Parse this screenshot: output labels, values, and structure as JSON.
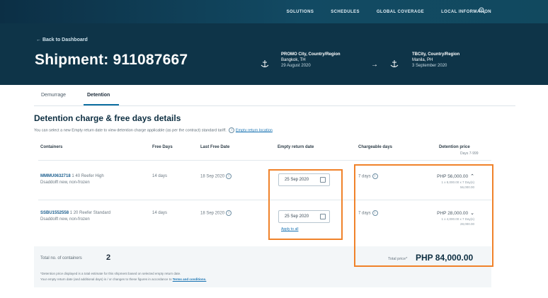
{
  "nav": {
    "links": [
      "SOLUTIONS",
      "SCHEDULES",
      "GLOBAL COVERAGE",
      "LOCAL INFORMATION"
    ]
  },
  "header": {
    "back_label": "← Back to Dashboard",
    "title": "Shipment: 911087667",
    "origin": {
      "location": "PROMO City, Country/Region",
      "city": "Bangkok, TH",
      "date": "29 August 2020"
    },
    "destination": {
      "location": "TBCity, Country/Region",
      "city": "Manila, PH",
      "date": "3 September 2020"
    }
  },
  "tabs": [
    "Demurrage",
    "Detention"
  ],
  "section": {
    "title": "Detention charge & free days details",
    "description": "You can select a new Empty return date to view detention charge applicable (as per the contract) standard tariff.",
    "link": "Empty return location"
  },
  "table": {
    "headers": [
      "Containers",
      "Free Days",
      "Last Free Date",
      "Empty return date",
      "Chargeable days",
      "Detention price"
    ],
    "price_sub": "Days 7-999",
    "rows": [
      {
        "container_id": "MMMU0632718",
        "container_desc": "1 40 Reefer High",
        "container_desc2": "Dsaddolft new, non-frozen",
        "free_days": "14 days",
        "last_free_date": "18 Sep 2020",
        "empty_return": "25 Sep 2020",
        "chargeable": "7 days",
        "price": "PHP 56,000.00",
        "price_sub1": "1 x 8,000.00 x 7 Day(s)",
        "price_sub2": "56,000.00"
      },
      {
        "container_id": "SSBU1552558",
        "container_desc": "1 20 Reefer Standard",
        "container_desc2": "Dsaddolft new, non-frozen",
        "free_days": "14 days",
        "last_free_date": "18 Sep 2020",
        "empty_return": "25 Sep 2020",
        "chargeable": "7 days",
        "price": "PHP 28,000.00",
        "price_sub1": "1 x 4,000.00 x 7 Day(s)",
        "price_sub2": "28,000.00"
      }
    ],
    "apply_label": "Apply to all"
  },
  "totals": {
    "count_label": "Total no. of containers",
    "count": "2",
    "price_label": "Total price*",
    "price": "PHP 84,000.00"
  },
  "notes": {
    "line1": "*Detention price displayed is a total estimate for this shipment based on selected empty return date.",
    "line2": "Your empty return date (and additional days) is / or changes to these figures in accordance to",
    "link": "Terms and conditions."
  },
  "colors": {
    "header": "#0e3448",
    "accent": "#0e6fa1",
    "highlight": "#f0822a"
  }
}
